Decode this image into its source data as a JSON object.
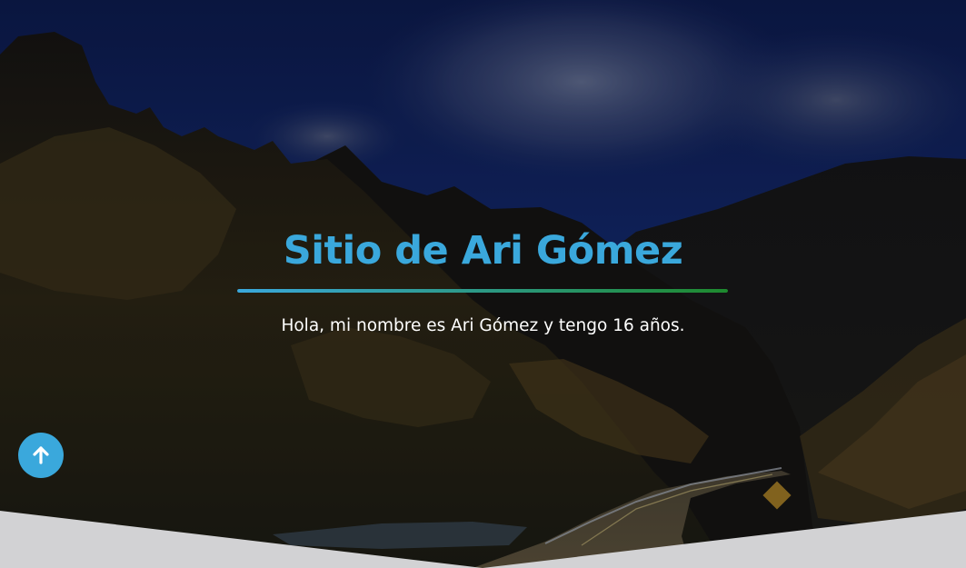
{
  "hero": {
    "title": "Sitio de Ari Gómez",
    "subtitle": "Hola, mi nombre es Ari Gómez y tengo 16 años.",
    "background": "mountain-road-photo"
  },
  "scroll_top_button": {
    "icon": "arrow-up-icon",
    "color": "#3aa8dc"
  },
  "colors": {
    "title": "#3aa8dc",
    "divider_start": "#3aa8dc",
    "divider_end": "#1e8a2e",
    "subtitle": "#ffffff",
    "page_background": "#ffffff"
  }
}
